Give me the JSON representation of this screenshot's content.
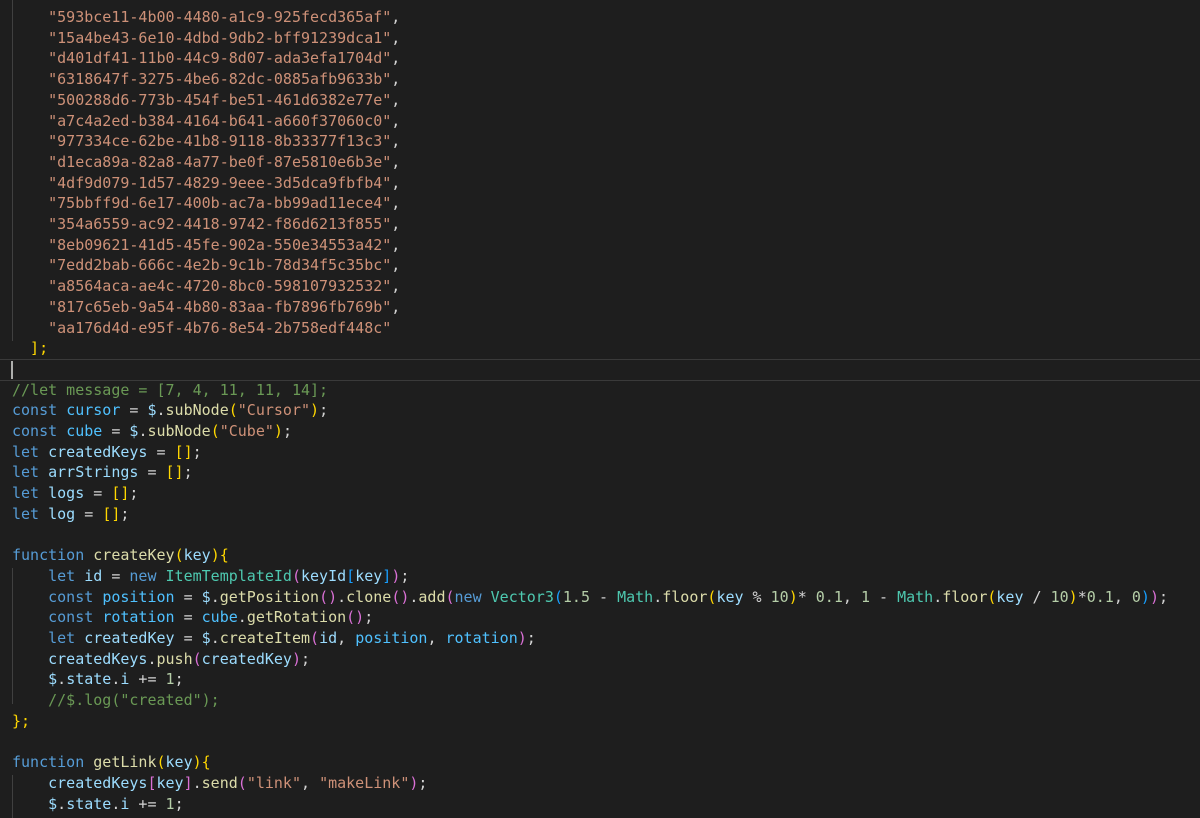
{
  "editor": {
    "array_items": [
      "593bce11-4b00-4480-a1c9-925fecd365af",
      "15a4be43-6e10-4dbd-9db2-bff91239dca1",
      "d401df41-11b0-44c9-8d07-ada3efa1704d",
      "6318647f-3275-4be6-82dc-0885afb9633b",
      "500288d6-773b-454f-be51-461d6382e77e",
      "a7c4a2ed-b384-4164-b641-a660f37060c0",
      "977334ce-62be-41b8-9118-8b33377f13c3",
      "d1eca89a-82a8-4a77-be0f-87e5810e6b3e",
      "4df9d079-1d57-4829-9eee-3d5dca9fbfb4",
      "75bbff9d-6e17-400b-ac7a-bb99ad11ece4",
      "354a6559-ac92-4418-9742-f86d6213f855",
      "8eb09621-41d5-45fe-902a-550e34553a42",
      "7edd2bab-666c-4e2b-9c1b-78d34f5c35bc",
      "a8564aca-ae4c-4720-8bc0-598107932532",
      "817c65eb-9a54-4b80-83aa-fb7896fb769b",
      "aa176d4d-e95f-4b76-8e54-2b758edf448c"
    ],
    "code_lines": [
      [
        [
          "  ];",
          "t-br1"
        ]
      ],
      [],
      [
        [
          "//let message = [7, 4, 11, 11, 14];",
          "t-cmt"
        ]
      ],
      [
        [
          "const",
          "t-kw"
        ],
        [
          " ",
          "t-plain"
        ],
        [
          "cursor",
          "t-const"
        ],
        [
          " = ",
          "t-op"
        ],
        [
          "$",
          "t-var"
        ],
        [
          ".",
          "t-plain"
        ],
        [
          "subNode",
          "t-fn"
        ],
        [
          "(",
          "t-br1"
        ],
        [
          "\"Cursor\"",
          "t-str"
        ],
        [
          ")",
          "t-br1"
        ],
        [
          ";",
          "t-plain"
        ]
      ],
      [
        [
          "const",
          "t-kw"
        ],
        [
          " ",
          "t-plain"
        ],
        [
          "cube",
          "t-const"
        ],
        [
          " = ",
          "t-op"
        ],
        [
          "$",
          "t-var"
        ],
        [
          ".",
          "t-plain"
        ],
        [
          "subNode",
          "t-fn"
        ],
        [
          "(",
          "t-br1"
        ],
        [
          "\"Cube\"",
          "t-str"
        ],
        [
          ")",
          "t-br1"
        ],
        [
          ";",
          "t-plain"
        ]
      ],
      [
        [
          "let",
          "t-kw"
        ],
        [
          " ",
          "t-plain"
        ],
        [
          "createdKeys",
          "t-var"
        ],
        [
          " = ",
          "t-op"
        ],
        [
          "[]",
          "t-br1"
        ],
        [
          ";",
          "t-plain"
        ]
      ],
      [
        [
          "let",
          "t-kw"
        ],
        [
          " ",
          "t-plain"
        ],
        [
          "arrStrings",
          "t-var"
        ],
        [
          " = ",
          "t-op"
        ],
        [
          "[]",
          "t-br1"
        ],
        [
          ";",
          "t-plain"
        ]
      ],
      [
        [
          "let",
          "t-kw"
        ],
        [
          " ",
          "t-plain"
        ],
        [
          "logs",
          "t-var"
        ],
        [
          " = ",
          "t-op"
        ],
        [
          "[]",
          "t-br1"
        ],
        [
          ";",
          "t-plain"
        ]
      ],
      [
        [
          "let",
          "t-kw"
        ],
        [
          " ",
          "t-plain"
        ],
        [
          "log",
          "t-var"
        ],
        [
          " = ",
          "t-op"
        ],
        [
          "[]",
          "t-br1"
        ],
        [
          ";",
          "t-plain"
        ]
      ],
      [],
      [
        [
          "function",
          "t-kw"
        ],
        [
          " ",
          "t-plain"
        ],
        [
          "createKey",
          "t-fn"
        ],
        [
          "(",
          "t-br1"
        ],
        [
          "key",
          "t-var"
        ],
        [
          "){",
          "t-br1"
        ]
      ],
      [
        [
          "    ",
          "t-plain"
        ],
        [
          "let",
          "t-kw"
        ],
        [
          " ",
          "t-plain"
        ],
        [
          "id",
          "t-var"
        ],
        [
          " = ",
          "t-op"
        ],
        [
          "new",
          "t-kw"
        ],
        [
          " ",
          "t-plain"
        ],
        [
          "ItemTemplateId",
          "t-cls"
        ],
        [
          "(",
          "t-br2"
        ],
        [
          "keyId",
          "t-var"
        ],
        [
          "[",
          "t-br3"
        ],
        [
          "key",
          "t-var"
        ],
        [
          "]",
          "t-br3"
        ],
        [
          ")",
          "t-br2"
        ],
        [
          ";",
          "t-plain"
        ]
      ],
      [
        [
          "    ",
          "t-plain"
        ],
        [
          "const",
          "t-kw"
        ],
        [
          " ",
          "t-plain"
        ],
        [
          "position",
          "t-const"
        ],
        [
          " = ",
          "t-op"
        ],
        [
          "$",
          "t-var"
        ],
        [
          ".",
          "t-plain"
        ],
        [
          "getPosition",
          "t-fn"
        ],
        [
          "()",
          "t-br2"
        ],
        [
          ".",
          "t-plain"
        ],
        [
          "clone",
          "t-fn"
        ],
        [
          "()",
          "t-br2"
        ],
        [
          ".",
          "t-plain"
        ],
        [
          "add",
          "t-fn"
        ],
        [
          "(",
          "t-br2"
        ],
        [
          "new",
          "t-kw"
        ],
        [
          " ",
          "t-plain"
        ],
        [
          "Vector3",
          "t-cls"
        ],
        [
          "(",
          "t-br3"
        ],
        [
          "1.5",
          "t-num"
        ],
        [
          " - ",
          "t-op"
        ],
        [
          "Math",
          "t-cls"
        ],
        [
          ".",
          "t-plain"
        ],
        [
          "floor",
          "t-fn"
        ],
        [
          "(",
          "t-br1"
        ],
        [
          "key",
          "t-var"
        ],
        [
          " % ",
          "t-op"
        ],
        [
          "10",
          "t-num"
        ],
        [
          ")",
          "t-br1"
        ],
        [
          "* ",
          "t-op"
        ],
        [
          "0.1",
          "t-num"
        ],
        [
          ", ",
          "t-plain"
        ],
        [
          "1",
          "t-num"
        ],
        [
          " - ",
          "t-op"
        ],
        [
          "Math",
          "t-cls"
        ],
        [
          ".",
          "t-plain"
        ],
        [
          "floor",
          "t-fn"
        ],
        [
          "(",
          "t-br1"
        ],
        [
          "key",
          "t-var"
        ],
        [
          " / ",
          "t-op"
        ],
        [
          "10",
          "t-num"
        ],
        [
          ")",
          "t-br1"
        ],
        [
          "*",
          "t-op"
        ],
        [
          "0.1",
          "t-num"
        ],
        [
          ", ",
          "t-plain"
        ],
        [
          "0",
          "t-num"
        ],
        [
          ")",
          "t-br3"
        ],
        [
          ")",
          "t-br2"
        ],
        [
          ";",
          "t-plain"
        ]
      ],
      [
        [
          "    ",
          "t-plain"
        ],
        [
          "const",
          "t-kw"
        ],
        [
          " ",
          "t-plain"
        ],
        [
          "rotation",
          "t-const"
        ],
        [
          " = ",
          "t-op"
        ],
        [
          "cube",
          "t-const"
        ],
        [
          ".",
          "t-plain"
        ],
        [
          "getRotation",
          "t-fn"
        ],
        [
          "()",
          "t-br2"
        ],
        [
          ";",
          "t-plain"
        ]
      ],
      [
        [
          "    ",
          "t-plain"
        ],
        [
          "let",
          "t-kw"
        ],
        [
          " ",
          "t-plain"
        ],
        [
          "createdKey",
          "t-var"
        ],
        [
          " = ",
          "t-op"
        ],
        [
          "$",
          "t-var"
        ],
        [
          ".",
          "t-plain"
        ],
        [
          "createItem",
          "t-fn"
        ],
        [
          "(",
          "t-br2"
        ],
        [
          "id",
          "t-var"
        ],
        [
          ", ",
          "t-plain"
        ],
        [
          "position",
          "t-const"
        ],
        [
          ", ",
          "t-plain"
        ],
        [
          "rotation",
          "t-const"
        ],
        [
          ")",
          "t-br2"
        ],
        [
          ";",
          "t-plain"
        ]
      ],
      [
        [
          "    ",
          "t-plain"
        ],
        [
          "createdKeys",
          "t-var"
        ],
        [
          ".",
          "t-plain"
        ],
        [
          "push",
          "t-fn"
        ],
        [
          "(",
          "t-br2"
        ],
        [
          "createdKey",
          "t-var"
        ],
        [
          ")",
          "t-br2"
        ],
        [
          ";",
          "t-plain"
        ]
      ],
      [
        [
          "    ",
          "t-plain"
        ],
        [
          "$",
          "t-var"
        ],
        [
          ".",
          "t-plain"
        ],
        [
          "state",
          "t-var"
        ],
        [
          ".",
          "t-plain"
        ],
        [
          "i",
          "t-var"
        ],
        [
          " += ",
          "t-op"
        ],
        [
          "1",
          "t-num"
        ],
        [
          ";",
          "t-plain"
        ]
      ],
      [
        [
          "    ",
          "t-plain"
        ],
        [
          "//$.log(\"created\");",
          "t-cmt"
        ]
      ],
      [
        [
          "};",
          "t-br1"
        ]
      ],
      [],
      [
        [
          "function",
          "t-kw"
        ],
        [
          " ",
          "t-plain"
        ],
        [
          "getLink",
          "t-fn"
        ],
        [
          "(",
          "t-br1"
        ],
        [
          "key",
          "t-var"
        ],
        [
          "){",
          "t-br1"
        ]
      ],
      [
        [
          "    ",
          "t-plain"
        ],
        [
          "createdKeys",
          "t-var"
        ],
        [
          "[",
          "t-br2"
        ],
        [
          "key",
          "t-var"
        ],
        [
          "]",
          "t-br2"
        ],
        [
          ".",
          "t-plain"
        ],
        [
          "send",
          "t-fn"
        ],
        [
          "(",
          "t-br2"
        ],
        [
          "\"link\"",
          "t-str"
        ],
        [
          ", ",
          "t-plain"
        ],
        [
          "\"makeLink\"",
          "t-str"
        ],
        [
          ")",
          "t-br2"
        ],
        [
          ";",
          "t-plain"
        ]
      ],
      [
        [
          "    ",
          "t-plain"
        ],
        [
          "$",
          "t-var"
        ],
        [
          ".",
          "t-plain"
        ],
        [
          "state",
          "t-var"
        ],
        [
          ".",
          "t-plain"
        ],
        [
          "i",
          "t-var"
        ],
        [
          " += ",
          "t-op"
        ],
        [
          "1",
          "t-num"
        ],
        [
          ";",
          "t-plain"
        ]
      ]
    ]
  }
}
